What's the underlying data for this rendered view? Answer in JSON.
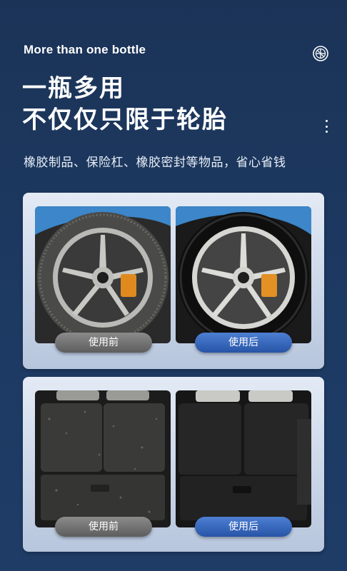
{
  "header": {
    "subtitle_en": "More than one bottle",
    "headline_line1": "一瓶多用",
    "headline_line2": "不仅仅只限于轮胎",
    "description": "橡胶制品、保险杠、橡胶密封等物品，省心省钱"
  },
  "icons": {
    "logo": "wheel-icon",
    "menu": "kebab-menu-icon"
  },
  "comparisons": [
    {
      "subject": "tire",
      "before_label": "使用前",
      "after_label": "使用后"
    },
    {
      "subject": "trunk",
      "before_label": "使用前",
      "after_label": "使用后"
    }
  ],
  "colors": {
    "background": "#1d3a63",
    "before_pill": "#6b6b6b",
    "after_pill": "#3565bd"
  }
}
